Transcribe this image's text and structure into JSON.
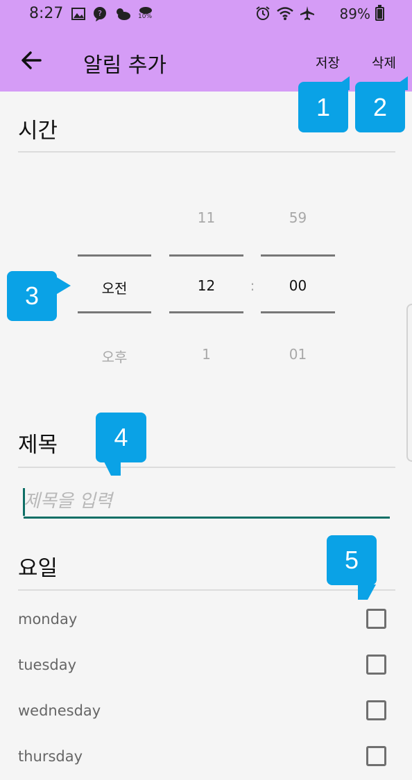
{
  "status_bar": {
    "time": "8:27",
    "battery_text": "89%",
    "battery_level": 0.89,
    "left_icons": [
      "image-icon",
      "messenger-icon",
      "weather-icon",
      "rain-chance-icon"
    ],
    "rain_chance_text": "10%",
    "right_icons": [
      "alarm-icon",
      "wifi-icon",
      "airplane-icon",
      "battery-icon"
    ]
  },
  "app_bar": {
    "back_icon": "arrow-left-icon",
    "title": "알림 추가",
    "save_label": "저장",
    "delete_label": "삭제",
    "background": "#d59cf6"
  },
  "time_section": {
    "title": "시간",
    "ampm": {
      "prev": "",
      "selected": "오전",
      "next": "오후"
    },
    "hour": {
      "prev": "11",
      "selected": "12",
      "next": "1"
    },
    "separator": ":",
    "minute": {
      "prev": "59",
      "selected": "00",
      "next": "01"
    }
  },
  "title_section": {
    "title": "제목",
    "input_value": "",
    "input_placeholder": "제목을 입력",
    "accent": "#0e6f66"
  },
  "day_section": {
    "title": "요일",
    "days": [
      {
        "label": "monday",
        "checked": false
      },
      {
        "label": "tuesday",
        "checked": false
      },
      {
        "label": "wednesday",
        "checked": false
      },
      {
        "label": "thursday",
        "checked": false
      }
    ]
  },
  "callouts": {
    "color": "#0aa2e6",
    "items": [
      {
        "number": "1"
      },
      {
        "number": "2"
      },
      {
        "number": "3"
      },
      {
        "number": "4"
      },
      {
        "number": "5"
      }
    ]
  }
}
